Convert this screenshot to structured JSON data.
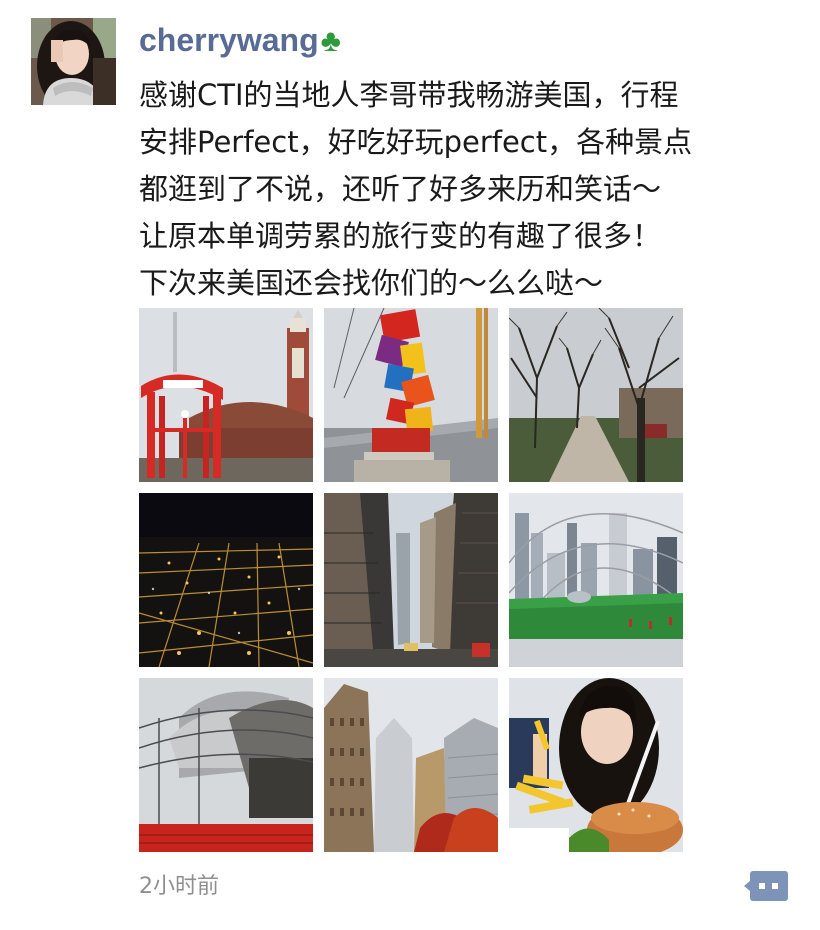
{
  "post": {
    "username": "cherrywang",
    "name_emoji": "♣",
    "text_lines": [
      "感谢CTI的当地人李哥带我畅游美国，行程",
      "安排Perfect，好吃好玩perfect，各种景点",
      "都逛到了不说，还听了好多来历和笑话～",
      "让原本单调劳累的旅行变的有趣了很多！",
      "下次来美国还会找你们的～么么哒～"
    ],
    "timestamp": "2小时前",
    "comment_icon": "comment-bubble-icon"
  },
  "photos": [
    {
      "scene": "navy-pier-red-arch"
    },
    {
      "scene": "colorful-letter-sculpture"
    },
    {
      "scene": "tree-lined-path"
    },
    {
      "scene": "city-lights-at-night"
    },
    {
      "scene": "downtown-street-canyon"
    },
    {
      "scene": "skyline-park-lawn"
    },
    {
      "scene": "pavilion-steel-trellis"
    },
    {
      "scene": "tall-buildings-upward"
    },
    {
      "scene": "selfie-with-burger"
    }
  ],
  "colors": {
    "username": "#576b95",
    "clover": "#2f9a3c",
    "text": "#1a1a1a",
    "timestamp": "#8f8f8f",
    "comment_icon_bg": "#7d93b8"
  }
}
